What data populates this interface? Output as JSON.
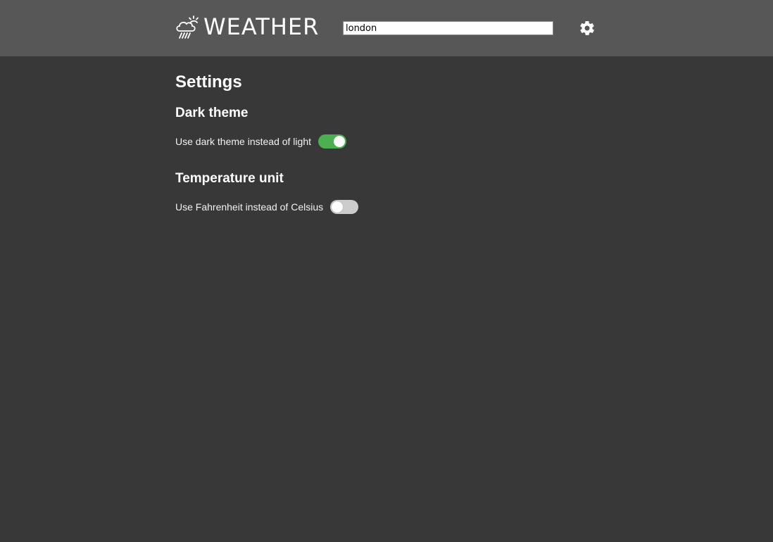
{
  "header": {
    "logo_text": "WEATHER",
    "logo_icon": "cloud-rain-sun-icon",
    "search": {
      "value": "london",
      "placeholder": ""
    },
    "settings_icon": "gear-icon"
  },
  "main": {
    "title": "Settings",
    "sections": [
      {
        "title": "Dark theme",
        "setting_label": "Use dark theme instead of light",
        "enabled": true
      },
      {
        "title": "Temperature unit",
        "setting_label": "Use Fahrenheit instead of Celsius",
        "enabled": false
      }
    ]
  },
  "colors": {
    "header_bg": "#575757",
    "page_bg": "#383838",
    "toggle_on": "#4caf50",
    "toggle_off": "#cccccc"
  }
}
